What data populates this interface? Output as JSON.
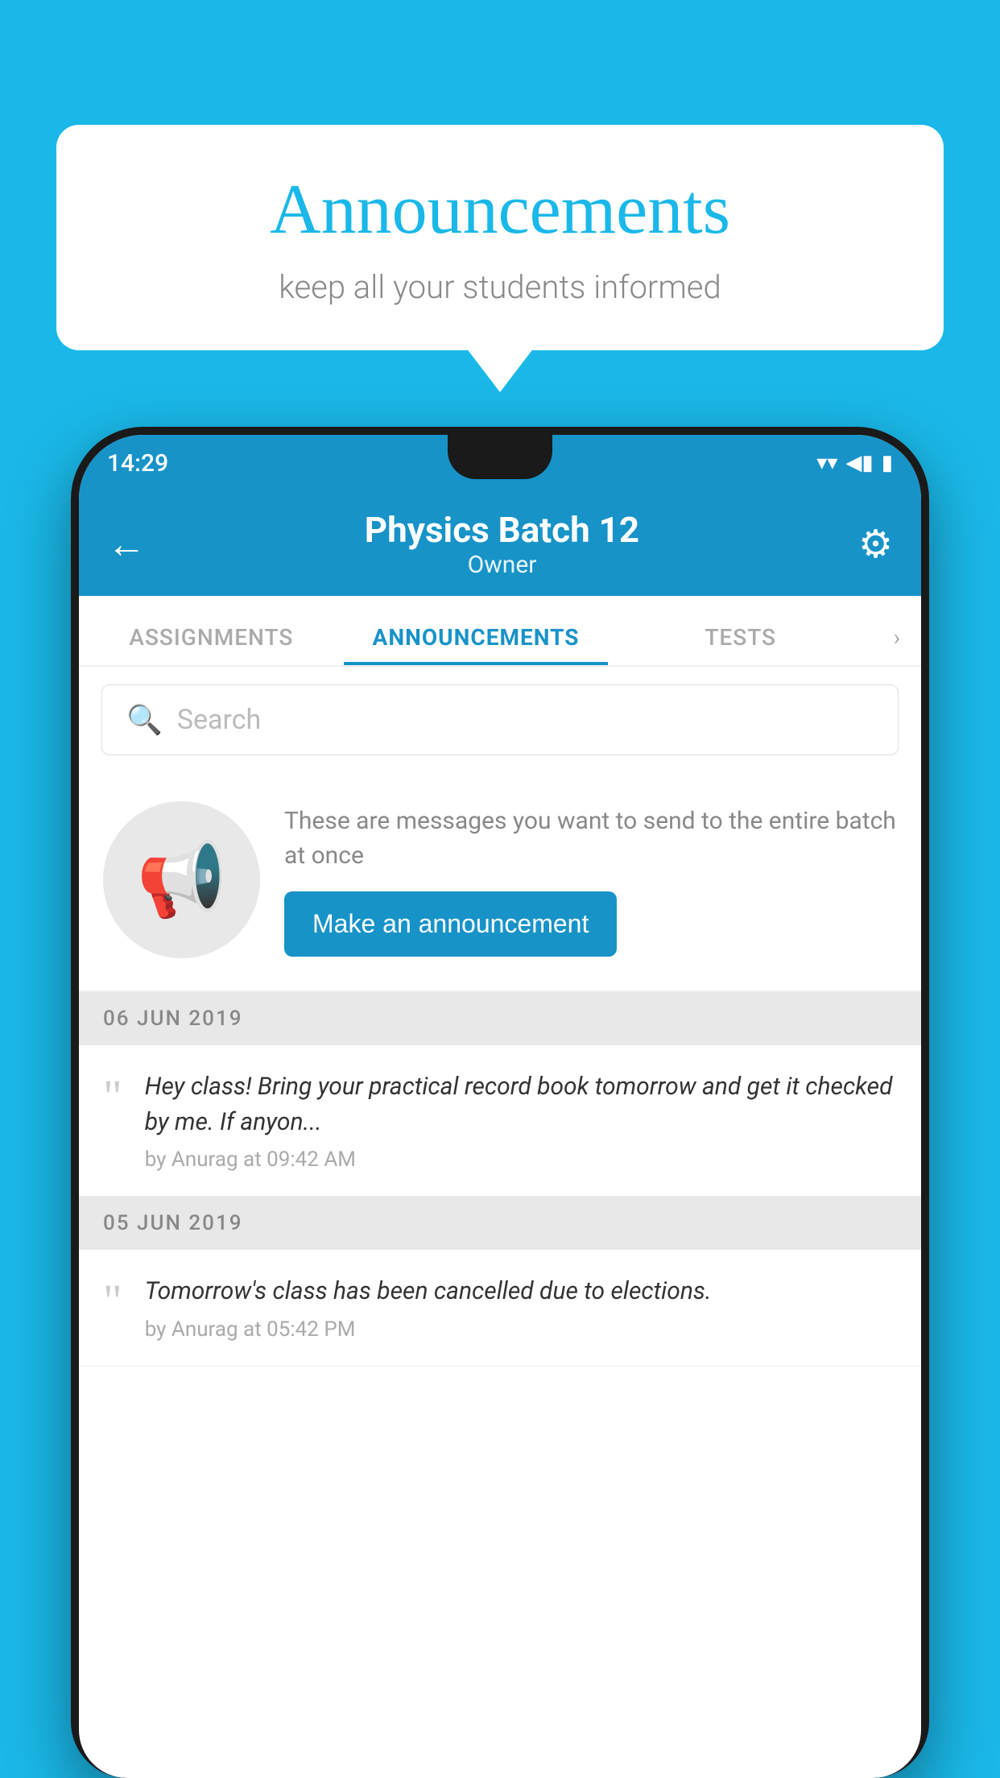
{
  "background_color": "#1ab8e8",
  "speech_bubble": {
    "title": "Announcements",
    "subtitle": "keep all your students informed"
  },
  "status_bar": {
    "time": "14:29",
    "wifi_icon": "▼",
    "signal_icon": "▲",
    "battery_icon": "▮"
  },
  "app_header": {
    "title": "Physics Batch 12",
    "subtitle": "Owner",
    "back_label": "←",
    "gear_label": "⚙"
  },
  "tabs": [
    {
      "label": "ASSIGNMENTS",
      "active": false
    },
    {
      "label": "ANNOUNCEMENTS",
      "active": true
    },
    {
      "label": "TESTS",
      "active": false
    }
  ],
  "search": {
    "placeholder": "Search"
  },
  "promo": {
    "description_text": "These are messages you want to send to the entire batch at once",
    "button_label": "Make an announcement"
  },
  "announcements": [
    {
      "date": "06  JUN  2019",
      "text": "Hey class! Bring your practical record book tomorrow and get it checked by me. If anyon...",
      "meta": "by Anurag at 09:42 AM"
    },
    {
      "date": "05  JUN  2019",
      "text": "Tomorrow's class has been cancelled due to elections.",
      "meta": "by Anurag at 05:42 PM"
    }
  ]
}
